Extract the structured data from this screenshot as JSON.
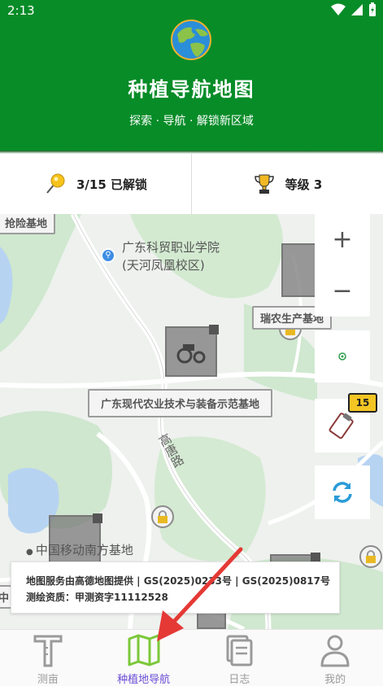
{
  "status": {
    "time": "2:13"
  },
  "header": {
    "title": "种植导航地图",
    "subtitle": "探索 · 导航 · 解锁新区域"
  },
  "stats": {
    "unlocked": "3/15 已解锁",
    "level": "等级 3"
  },
  "map": {
    "labels": {
      "top_left": "抢险基地",
      "base_right": "瑞农生产基地",
      "center": "广东现代农业技术与装备示范基地",
      "poi_line1": "广东科贸职业学院",
      "poi_line2": "(天河凤凰校区)",
      "road": "高唐路",
      "south": "中国移动南方基地",
      "left_edge": "中"
    },
    "badge_count": "15"
  },
  "attribution": {
    "line1": "地图服务由高德地图提供 | GS(2025)0233号 | GS(2025)0817号",
    "line2": "测绘资质：甲测资字11112528"
  },
  "nav": {
    "items": [
      {
        "label": "测亩",
        "icon": "ruler-icon"
      },
      {
        "label": "种植地导航",
        "icon": "map-icon"
      },
      {
        "label": "日志",
        "icon": "log-icon"
      },
      {
        "label": "我的",
        "icon": "user-icon"
      }
    ]
  },
  "colors": {
    "header_green": "#078c28",
    "active_nav": "#6b4dd6",
    "active_icon": "#7cc83a",
    "badge": "#f4c623",
    "arrow": "#e53935"
  }
}
